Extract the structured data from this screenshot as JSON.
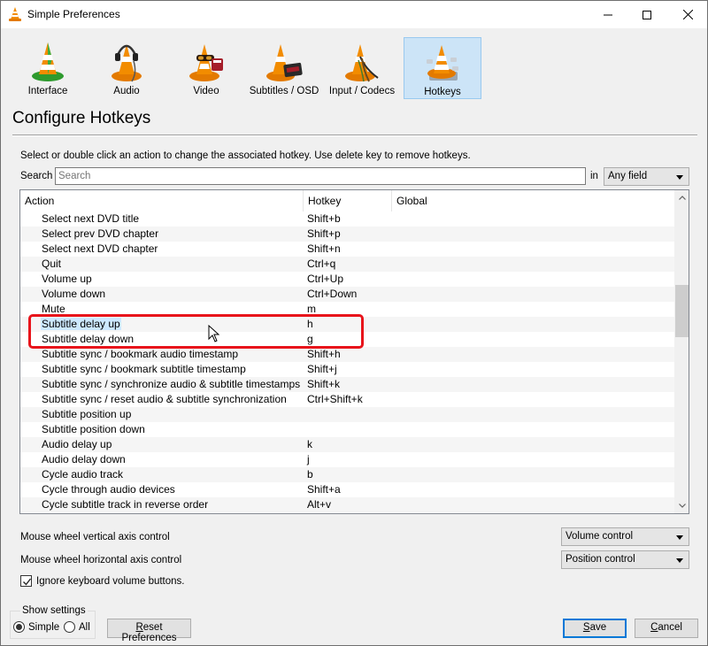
{
  "window": {
    "title": "Simple Preferences",
    "controls": {
      "minimize": "minimize",
      "maximize": "maximize",
      "close": "close"
    }
  },
  "categories": [
    {
      "label": "Interface",
      "icon": "vlc-cone-interface-icon",
      "active": false
    },
    {
      "label": "Audio",
      "icon": "vlc-cone-headphones-icon",
      "active": false
    },
    {
      "label": "Video",
      "icon": "vlc-cone-glasses-icon",
      "active": false
    },
    {
      "label": "Subtitles / OSD",
      "icon": "vlc-cone-display-icon",
      "active": false
    },
    {
      "label": "Input / Codecs",
      "icon": "vlc-cone-cables-icon",
      "active": false
    },
    {
      "label": "Hotkeys",
      "icon": "vlc-cone-hotkeys-icon",
      "active": true
    }
  ],
  "section": {
    "title": "Configure Hotkeys",
    "hint": "Select or double click an action to change the associated hotkey. Use delete key to remove hotkeys."
  },
  "search": {
    "label": "Search",
    "value": "",
    "placeholder": "Search",
    "in_label": "in",
    "field_selected": "Any field"
  },
  "table": {
    "columns": [
      "Action",
      "Hotkey",
      "Global"
    ],
    "rows": [
      {
        "action": "Select next DVD title",
        "hotkey": "Shift+b",
        "global": ""
      },
      {
        "action": "Select prev DVD chapter",
        "hotkey": "Shift+p",
        "global": ""
      },
      {
        "action": "Select next DVD chapter",
        "hotkey": "Shift+n",
        "global": ""
      },
      {
        "action": "Quit",
        "hotkey": "Ctrl+q",
        "global": ""
      },
      {
        "action": "Volume up",
        "hotkey": "Ctrl+Up",
        "global": ""
      },
      {
        "action": "Volume down",
        "hotkey": "Ctrl+Down",
        "global": ""
      },
      {
        "action": "Mute",
        "hotkey": "m",
        "global": ""
      },
      {
        "action": "Subtitle delay up",
        "hotkey": "h",
        "global": "",
        "selected": true
      },
      {
        "action": "Subtitle delay down",
        "hotkey": "g",
        "global": ""
      },
      {
        "action": "Subtitle sync / bookmark audio timestamp",
        "hotkey": "Shift+h",
        "global": ""
      },
      {
        "action": "Subtitle sync / bookmark subtitle timestamp",
        "hotkey": "Shift+j",
        "global": ""
      },
      {
        "action": "Subtitle sync / synchronize audio & subtitle timestamps",
        "hotkey": "Shift+k",
        "global": ""
      },
      {
        "action": "Subtitle sync / reset audio & subtitle synchronization",
        "hotkey": "Ctrl+Shift+k",
        "global": ""
      },
      {
        "action": "Subtitle position up",
        "hotkey": "",
        "global": ""
      },
      {
        "action": "Subtitle position down",
        "hotkey": "",
        "global": ""
      },
      {
        "action": "Audio delay up",
        "hotkey": "k",
        "global": ""
      },
      {
        "action": "Audio delay down",
        "hotkey": "j",
        "global": ""
      },
      {
        "action": "Cycle audio track",
        "hotkey": "b",
        "global": ""
      },
      {
        "action": "Cycle through audio devices",
        "hotkey": "Shift+a",
        "global": ""
      },
      {
        "action": "Cycle subtitle track in reverse order",
        "hotkey": "Alt+v",
        "global": ""
      }
    ]
  },
  "options": {
    "wheel_vertical_label": "Mouse wheel vertical axis control",
    "wheel_vertical_value": "Volume control",
    "wheel_horizontal_label": "Mouse wheel horizontal axis control",
    "wheel_horizontal_value": "Position control",
    "ignore_volume_label": "Ignore keyboard volume buttons.",
    "ignore_volume_checked": true
  },
  "show_settings": {
    "title": "Show settings",
    "simple_label": "Simple",
    "all_label": "All",
    "selected": "Simple"
  },
  "buttons": {
    "reset_first": "R",
    "reset_rest": "eset Preferences",
    "save_first": "S",
    "save_rest": "ave",
    "cancel_first": "C",
    "cancel_rest": "ancel"
  },
  "colors": {
    "accent": "#0078d7",
    "selection": "#cce8ff",
    "active_tab": "#cce4f7",
    "annotation_box": "#e8141b"
  }
}
